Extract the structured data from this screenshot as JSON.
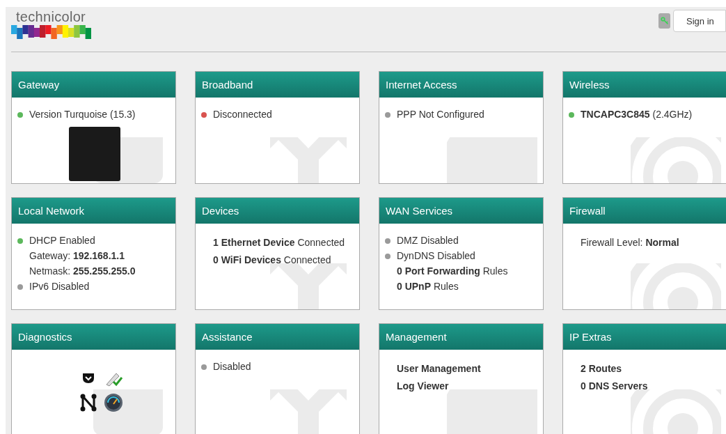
{
  "header": {
    "logo": "technicolor",
    "sign_in": "Sign in"
  },
  "cards": [
    {
      "title": "Gateway",
      "lines": [
        {
          "kind": "status",
          "text": "Version Turquoise (15.3)",
          "color": "#5cb85c"
        }
      ],
      "kind": "photo"
    },
    {
      "title": "Broadband",
      "lines": [
        {
          "kind": "status",
          "text": "Disconnected",
          "color": "#d9534f"
        }
      ]
    },
    {
      "title": "Internet Access",
      "lines": [
        {
          "kind": "status",
          "text": "PPP Not Configured",
          "color": "#9a9a9a"
        }
      ]
    },
    {
      "title": "Wireless",
      "lines": [
        {
          "kind": "status",
          "text": "**TNCAPC3C845** (2.4GHz)",
          "color": "#5cb85c"
        }
      ]
    },
    {
      "title": "Local Network",
      "lines": [
        {
          "kind": "status",
          "text": "DHCP Enabled",
          "color": "#5cb85c"
        },
        {
          "kind": "detail",
          "text": "Gateway: **192.168.1.1**"
        },
        {
          "kind": "detail",
          "text": "Netmask: **255.255.255.0**"
        },
        {
          "kind": "status",
          "text": "IPv6 Disabled",
          "color": "#9a9a9a"
        }
      ]
    },
    {
      "title": "Devices",
      "lines": [
        {
          "kind": "info",
          "text": "**1 Ethernet Device** Connected"
        },
        {
          "kind": "info",
          "text": "**0 WiFi Devices** Connected"
        }
      ]
    },
    {
      "title": "WAN Services",
      "lines": [
        {
          "kind": "status",
          "text": "DMZ Disabled",
          "color": "#9a9a9a"
        },
        {
          "kind": "status",
          "text": "DynDNS Disabled",
          "color": "#9a9a9a"
        },
        {
          "kind": "detail",
          "text": "**0 Port Forwarding** Rules"
        },
        {
          "kind": "detail",
          "text": "**0 UPnP** Rules"
        }
      ]
    },
    {
      "title": "Firewall",
      "lines": [
        {
          "kind": "info",
          "text": "Firewall Level: **Normal**"
        }
      ]
    },
    {
      "title": "Diagnostics",
      "kind": "icons"
    },
    {
      "title": "Assistance",
      "lines": [
        {
          "kind": "status",
          "text": "Disabled",
          "color": "#9a9a9a"
        }
      ]
    },
    {
      "title": "Management",
      "lines": [
        {
          "kind": "link",
          "text": "User Management"
        },
        {
          "kind": "link",
          "text": "Log Viewer"
        }
      ]
    },
    {
      "title": "IP Extras",
      "lines": [
        {
          "kind": "link",
          "text": "2 Routes"
        },
        {
          "kind": "link",
          "text": "0 DNS Servers"
        }
      ]
    }
  ]
}
